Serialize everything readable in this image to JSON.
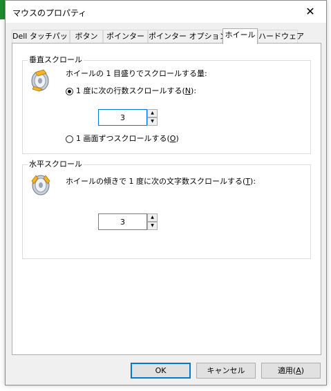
{
  "window": {
    "title": "マウスのプロパティ",
    "close_glyph": "✕"
  },
  "tabs": [
    {
      "label": "Dell タッチパッド",
      "active": false
    },
    {
      "label": "ボタン",
      "active": false
    },
    {
      "label": "ポインター",
      "active": false
    },
    {
      "label": "ポインター オプション",
      "active": false
    },
    {
      "label": "ホイール",
      "active": true
    },
    {
      "label": "ハードウェア",
      "active": false
    }
  ],
  "vertical_scroll": {
    "group_title": "垂直スクロール",
    "description": "ホイールの 1 目盛りでスクロールする量:",
    "option_lines": {
      "label_prefix": "1 度に次の行数スクロールする(",
      "accel": "N",
      "label_suffix": "):",
      "checked": true
    },
    "lines_value": "3",
    "option_screen": {
      "label_prefix": "1 画面ずつスクロールする(",
      "accel": "O",
      "label_suffix": ")",
      "checked": false
    }
  },
  "horizontal_scroll": {
    "group_title": "水平スクロール",
    "description_prefix": "ホイールの傾きで 1 度に次の文字数スクロールする(",
    "accel": "T",
    "description_suffix": "):",
    "chars_value": "3"
  },
  "buttons": {
    "ok": "OK",
    "cancel": "キャンセル",
    "apply_prefix": "適用(",
    "apply_accel": "A",
    "apply_suffix": ")"
  },
  "icons": {
    "wheel": "mouse-wheel-icon",
    "spin_up": "▲",
    "spin_down": "▼"
  },
  "colors": {
    "accent": "#0078d7",
    "dialog_bg": "#f0f0f0",
    "panel_bg": "#ffffff",
    "background_app_strip": "#1f8c2e"
  }
}
